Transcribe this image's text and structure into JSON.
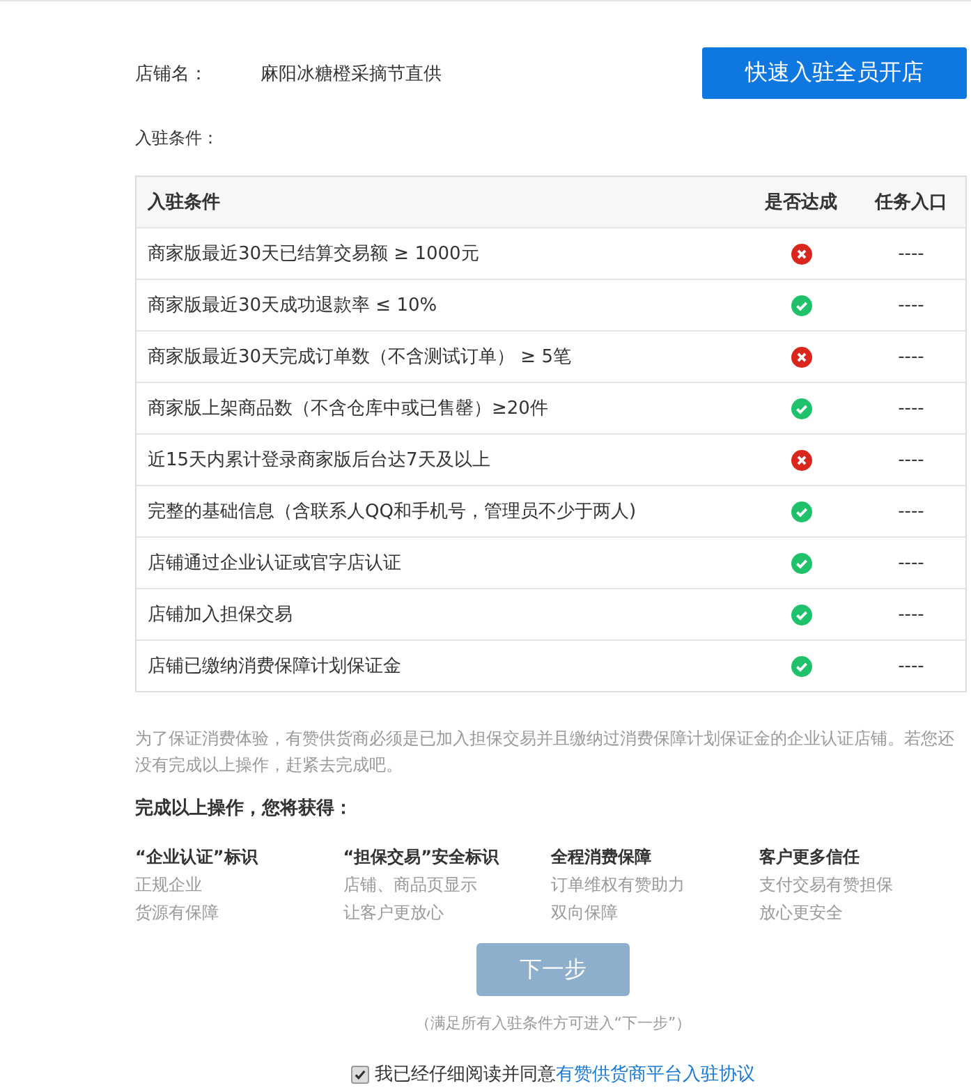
{
  "shop": {
    "label": "店铺名：",
    "name": "麻阳冰糖橙采摘节直供"
  },
  "quick_button": {
    "label": "快速入驻全员开店"
  },
  "conditions_label": "入驻条件：",
  "table": {
    "columns": [
      "入驻条件",
      "是否达成",
      "任务入口"
    ],
    "rows": [
      {
        "condition": "商家版最近30天已结算交易额 ≥ 1000元",
        "met": false,
        "entry": "----"
      },
      {
        "condition": "商家版最近30天成功退款率 ≤ 10%",
        "met": true,
        "entry": "----"
      },
      {
        "condition": "商家版最近30天完成订单数（不含测试订单） ≥ 5笔",
        "met": false,
        "entry": "----"
      },
      {
        "condition": "商家版上架商品数（不含仓库中或已售罄）≥20件",
        "met": true,
        "entry": "----"
      },
      {
        "condition": "近15天内累计登录商家版后台达7天及以上",
        "met": false,
        "entry": "----"
      },
      {
        "condition": "完整的基础信息（含联系人QQ和手机号，管理员不少于两人)",
        "met": true,
        "entry": "----"
      },
      {
        "condition": "店铺通过企业认证或官字店认证",
        "met": true,
        "entry": "----"
      },
      {
        "condition": "店铺加入担保交易",
        "met": true,
        "entry": "----"
      },
      {
        "condition": "店铺已缴纳消费保障计划保证金",
        "met": true,
        "entry": "----"
      }
    ]
  },
  "notice": "为了保证消费体验，有赞供货商必须是已加入担保交易并且缴纳过消费保障计划保证金的企业认证店铺。若您还没有完成以上操作，赶紧去完成吧。",
  "benefits_title": "完成以上操作，您将获得：",
  "benefits": [
    {
      "title": "“企业认证”标识",
      "lines": [
        "正规企业",
        "货源有保障"
      ]
    },
    {
      "title": "“担保交易”安全标识",
      "lines": [
        "店铺、商品页显示",
        "让客户更放心"
      ]
    },
    {
      "title": "全程消费保障",
      "lines": [
        "订单维权有赞助力",
        "双向保障"
      ]
    },
    {
      "title": "客户更多信任",
      "lines": [
        "支付交易有赞担保",
        "放心更安全"
      ]
    }
  ],
  "next_button": {
    "label": "下一步",
    "disabled": true
  },
  "next_hint": "（满足所有入驻条件方可进入“下一步”）",
  "agreement": {
    "checked": true,
    "text": "我已经仔细阅读并同意",
    "link": "有赞供货商平台入驻协议"
  }
}
